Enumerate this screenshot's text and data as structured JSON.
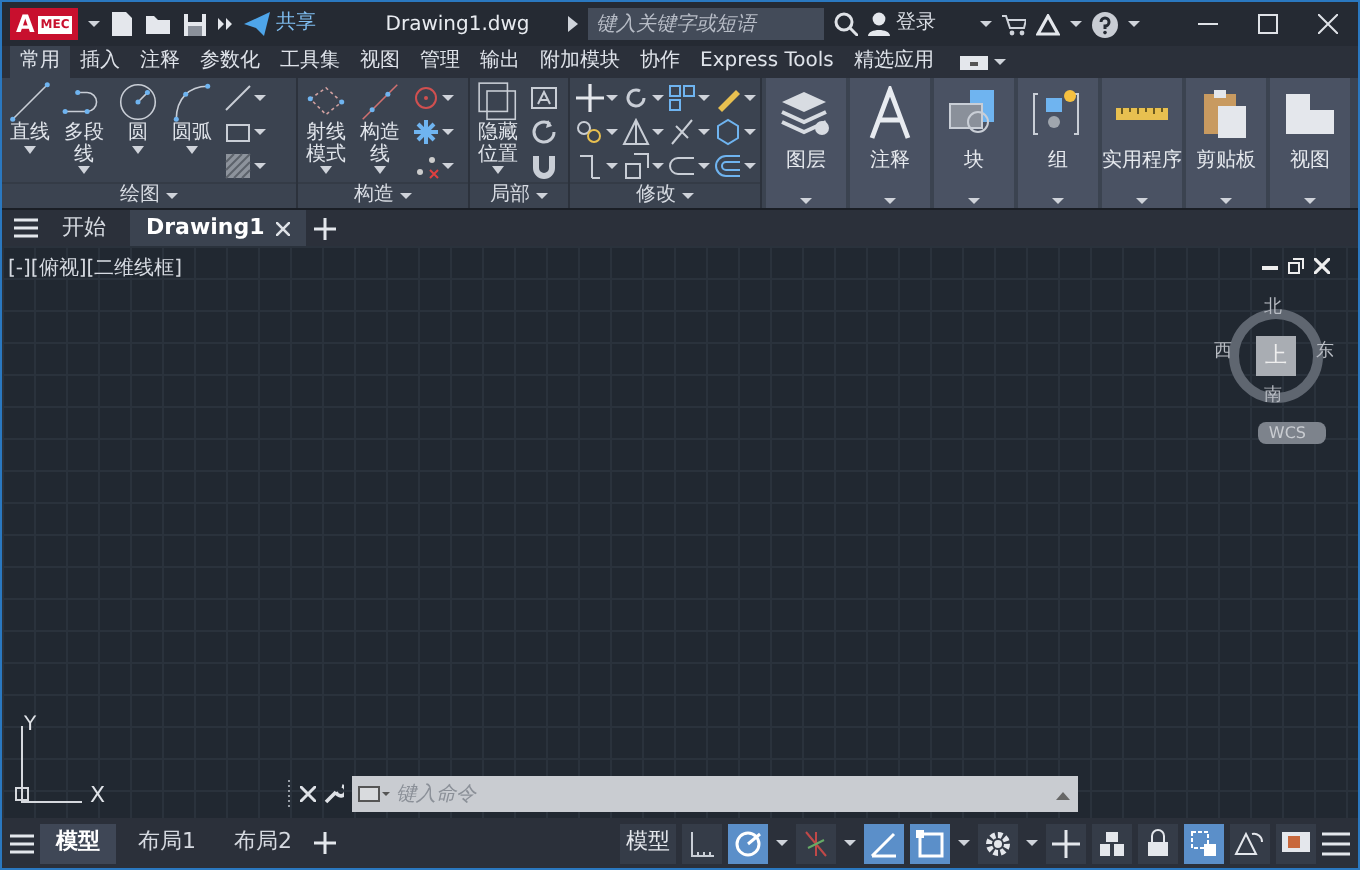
{
  "title_bar": {
    "logo": "A",
    "logo_badge": "MEC",
    "share": "共享",
    "document_title": "Drawing1.dwg",
    "search": {
      "placeholder": "键入关键字或短语"
    },
    "sign_in": "登录"
  },
  "ribbon_tabs": [
    {
      "label": "常用",
      "selected": true
    },
    {
      "label": "插入",
      "selected": false
    },
    {
      "label": "注释",
      "selected": false
    },
    {
      "label": "参数化",
      "selected": false
    },
    {
      "label": "工具集",
      "selected": false
    },
    {
      "label": "视图",
      "selected": false
    },
    {
      "label": "管理",
      "selected": false
    },
    {
      "label": "输出",
      "selected": false
    },
    {
      "label": "附加模块",
      "selected": false
    },
    {
      "label": "协作",
      "selected": false
    },
    {
      "label": "Express Tools",
      "selected": false
    },
    {
      "label": "精选应用",
      "selected": false
    }
  ],
  "ribbon_panels": [
    {
      "kind": "draw",
      "title": "绘图",
      "tools": [
        "直线",
        "多段线",
        "圆",
        "圆弧"
      ]
    },
    {
      "kind": "construct",
      "title": "构造",
      "tools": [
        "射线模式",
        "构造线"
      ]
    },
    {
      "kind": "local",
      "title": "局部",
      "tools": [
        "隐藏位置"
      ]
    },
    {
      "kind": "modify",
      "title": "修改"
    }
  ],
  "ribbon_buttons": [
    {
      "kind": "layers",
      "label": "图层"
    },
    {
      "kind": "annotation",
      "label": "注释"
    },
    {
      "kind": "block",
      "label": "块"
    },
    {
      "kind": "group",
      "label": "组"
    },
    {
      "kind": "utilities",
      "label": "实用程序"
    },
    {
      "kind": "clipboard",
      "label": "剪贴板"
    },
    {
      "kind": "view",
      "label": "视图"
    }
  ],
  "document_tabs": [
    {
      "label": "开始",
      "selected": false
    },
    {
      "label": "Drawing1",
      "selected": true
    }
  ],
  "viewport": {
    "label": "[-][俯视][二维线框]",
    "viewcube": {
      "top": "上",
      "north": "北",
      "south": "南",
      "east": "东",
      "west": "西",
      "coordinate_system": "WCS"
    },
    "ucs": {
      "y": "Y",
      "x": "X"
    }
  },
  "command_line": {
    "placeholder": "键入命令"
  },
  "layout_tabs": [
    {
      "label": "模型",
      "selected": true
    },
    {
      "label": "布局1",
      "selected": false
    },
    {
      "label": "布局2",
      "selected": false
    }
  ],
  "status_bar": {
    "space": "模型",
    "toggles": [
      {
        "kind": "grid",
        "on": false,
        "menu": false
      },
      {
        "kind": "polar",
        "on": true,
        "menu": true
      },
      {
        "kind": "tracking",
        "on": false,
        "menu": true
      },
      {
        "kind": "angle",
        "on": true,
        "menu": false
      },
      {
        "kind": "square",
        "on": true,
        "menu": true
      },
      {
        "kind": "gear",
        "on": false,
        "menu": true
      },
      {
        "kind": "plus",
        "on": false,
        "menu": false
      },
      {
        "kind": "blocks",
        "on": false,
        "menu": false
      },
      {
        "kind": "lock",
        "on": false,
        "menu": false
      },
      {
        "kind": "select",
        "on": true,
        "menu": false
      },
      {
        "kind": "triangle",
        "on": false,
        "menu": false
      },
      {
        "kind": "monitor",
        "on": false,
        "menu": false
      }
    ]
  }
}
